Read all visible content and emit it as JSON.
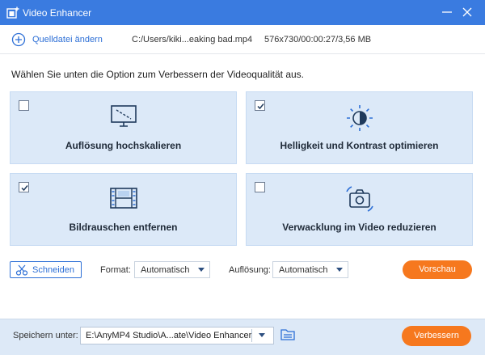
{
  "window": {
    "title": "Video Enhancer",
    "icons": {
      "app": "app-add-icon",
      "minimize": "minimize-icon",
      "close": "close-icon"
    }
  },
  "source": {
    "add_label": "Quelldatei ändern",
    "file_path": "C:/Users/kiki...eaking bad.mp4",
    "file_info": "576x730/00:00:27/3,56 MB",
    "icon": "plus-circle-icon"
  },
  "instruction": "Wählen Sie unten die Option zum Verbessern der Videoqualität aus.",
  "options": [
    {
      "label": "Auflösung hochskalieren",
      "checked": false,
      "icon": "monitor-upscale-icon"
    },
    {
      "label": "Helligkeit und Kontrast optimieren",
      "checked": true,
      "icon": "brightness-icon"
    },
    {
      "label": "Bildrauschen entfernen",
      "checked": true,
      "icon": "film-strip-icon"
    },
    {
      "label": "Verwacklung im Video reduzieren",
      "checked": false,
      "icon": "camera-shake-icon"
    }
  ],
  "controls": {
    "cut_label": "Schneiden",
    "format_label": "Format:",
    "format_value": "Automatisch",
    "resolution_label": "Auflösung:",
    "resolution_value": "Automatisch",
    "preview_label": "Vorschau"
  },
  "footer": {
    "save_label": "Speichern unter:",
    "save_path": "E:\\AnyMP4 Studio\\A...ate\\Video Enhancer",
    "enhance_label": "Verbessern",
    "folder_icon": "folder-icon"
  },
  "colors": {
    "accent_blue": "#3a7be0",
    "link_blue": "#2d6fd6",
    "card_bg": "#dce9f8",
    "orange": "#f6781e",
    "footer_bg": "#dde9f7"
  }
}
